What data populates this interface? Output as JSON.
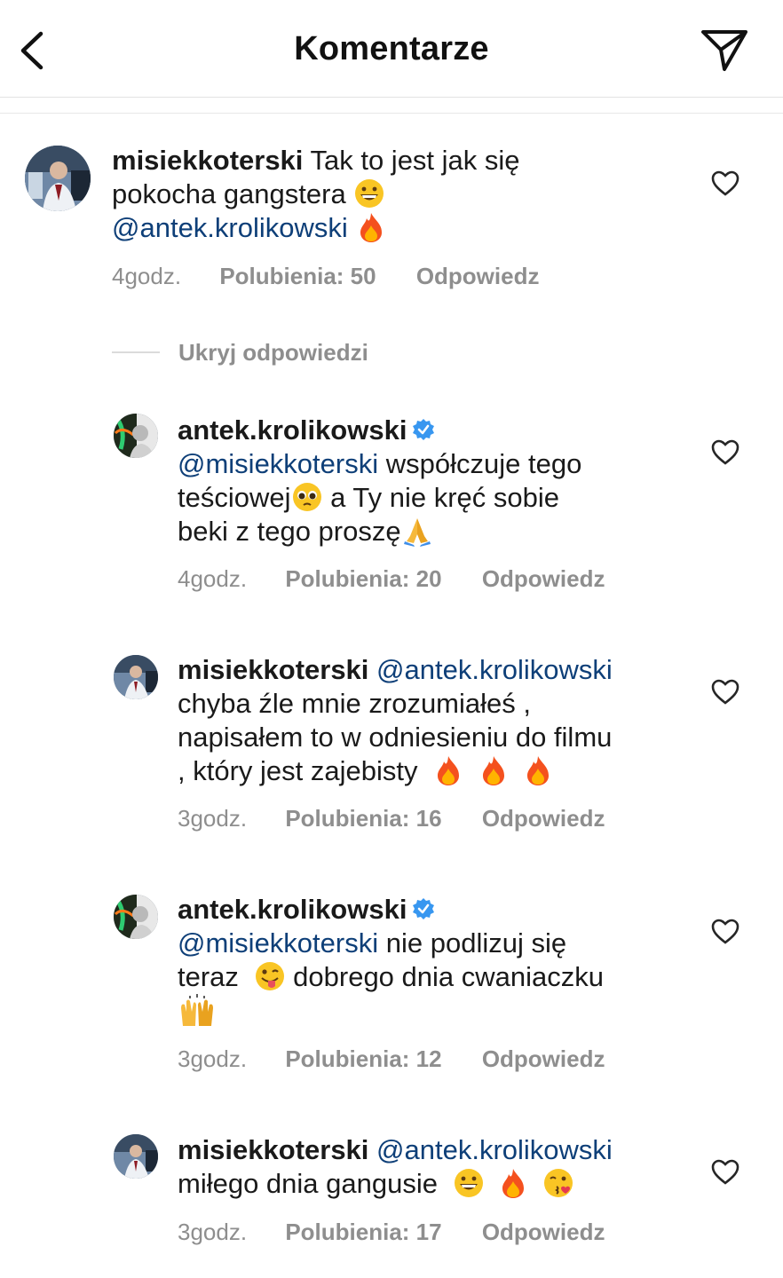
{
  "header": {
    "title": "Komentarze"
  },
  "hide_replies_label": "Ukryj odpowiedzi",
  "comments": [
    {
      "user": "misiekkoterski",
      "text_1": "Tak to jest jak się",
      "text_2": "pokocha gangstera",
      "mention": "@antek.krolikowski",
      "time": "4godz.",
      "likes": "Polubienia: 50",
      "reply": "Odpowiedz",
      "emojis": [
        "grinning-face",
        "fire"
      ]
    },
    {
      "user": "antek.krolikowski",
      "verified": true,
      "mention": "@misiekkoterski",
      "text_1": " współczuje tego",
      "text_2": "teściowej",
      "text_3": " a Ty nie kręć sobie",
      "text_4": "beki z tego proszę",
      "time": "4godz.",
      "likes": "Polubienia: 20",
      "reply": "Odpowiedz",
      "emojis": [
        "pleading-face",
        "folded-hands"
      ]
    },
    {
      "user": "misiekkoterski",
      "mention": "@antek.krolikowski",
      "text_1": "chyba źle mnie zrozumiałeś ,",
      "text_2": "napisałem to w odniesieniu do filmu",
      "text_3": ", który jest zajebisty",
      "time": "3godz.",
      "likes": "Polubienia: 16",
      "reply": "Odpowiedz",
      "emojis": [
        "fire",
        "fire",
        "fire"
      ]
    },
    {
      "user": "antek.krolikowski",
      "verified": true,
      "mention": "@misiekkoterski",
      "text_1": " nie podlizuj się",
      "text_2": "teraz",
      "text_3": " dobrego dnia cwaniaczku",
      "time": "3godz.",
      "likes": "Polubienia: 12",
      "reply": "Odpowiedz",
      "emojis": [
        "winking-face-with-tongue",
        "raising-hands"
      ]
    },
    {
      "user": "misiekkoterski",
      "mention": "@antek.krolikowski",
      "text_1": "miłego dnia gangusie",
      "time": "3godz.",
      "likes": "Polubienia: 17",
      "reply": "Odpowiedz",
      "emojis": [
        "grinning-face",
        "fire",
        "face-blowing-kiss"
      ]
    }
  ],
  "icons": {
    "back": "chevron-left-icon",
    "send": "paper-plane-icon",
    "like": "heart-outline-icon",
    "verified": "verified-badge-icon"
  },
  "colors": {
    "mention": "#0e3f78",
    "meta": "#8e8e8e",
    "verified": "#3897f0"
  }
}
